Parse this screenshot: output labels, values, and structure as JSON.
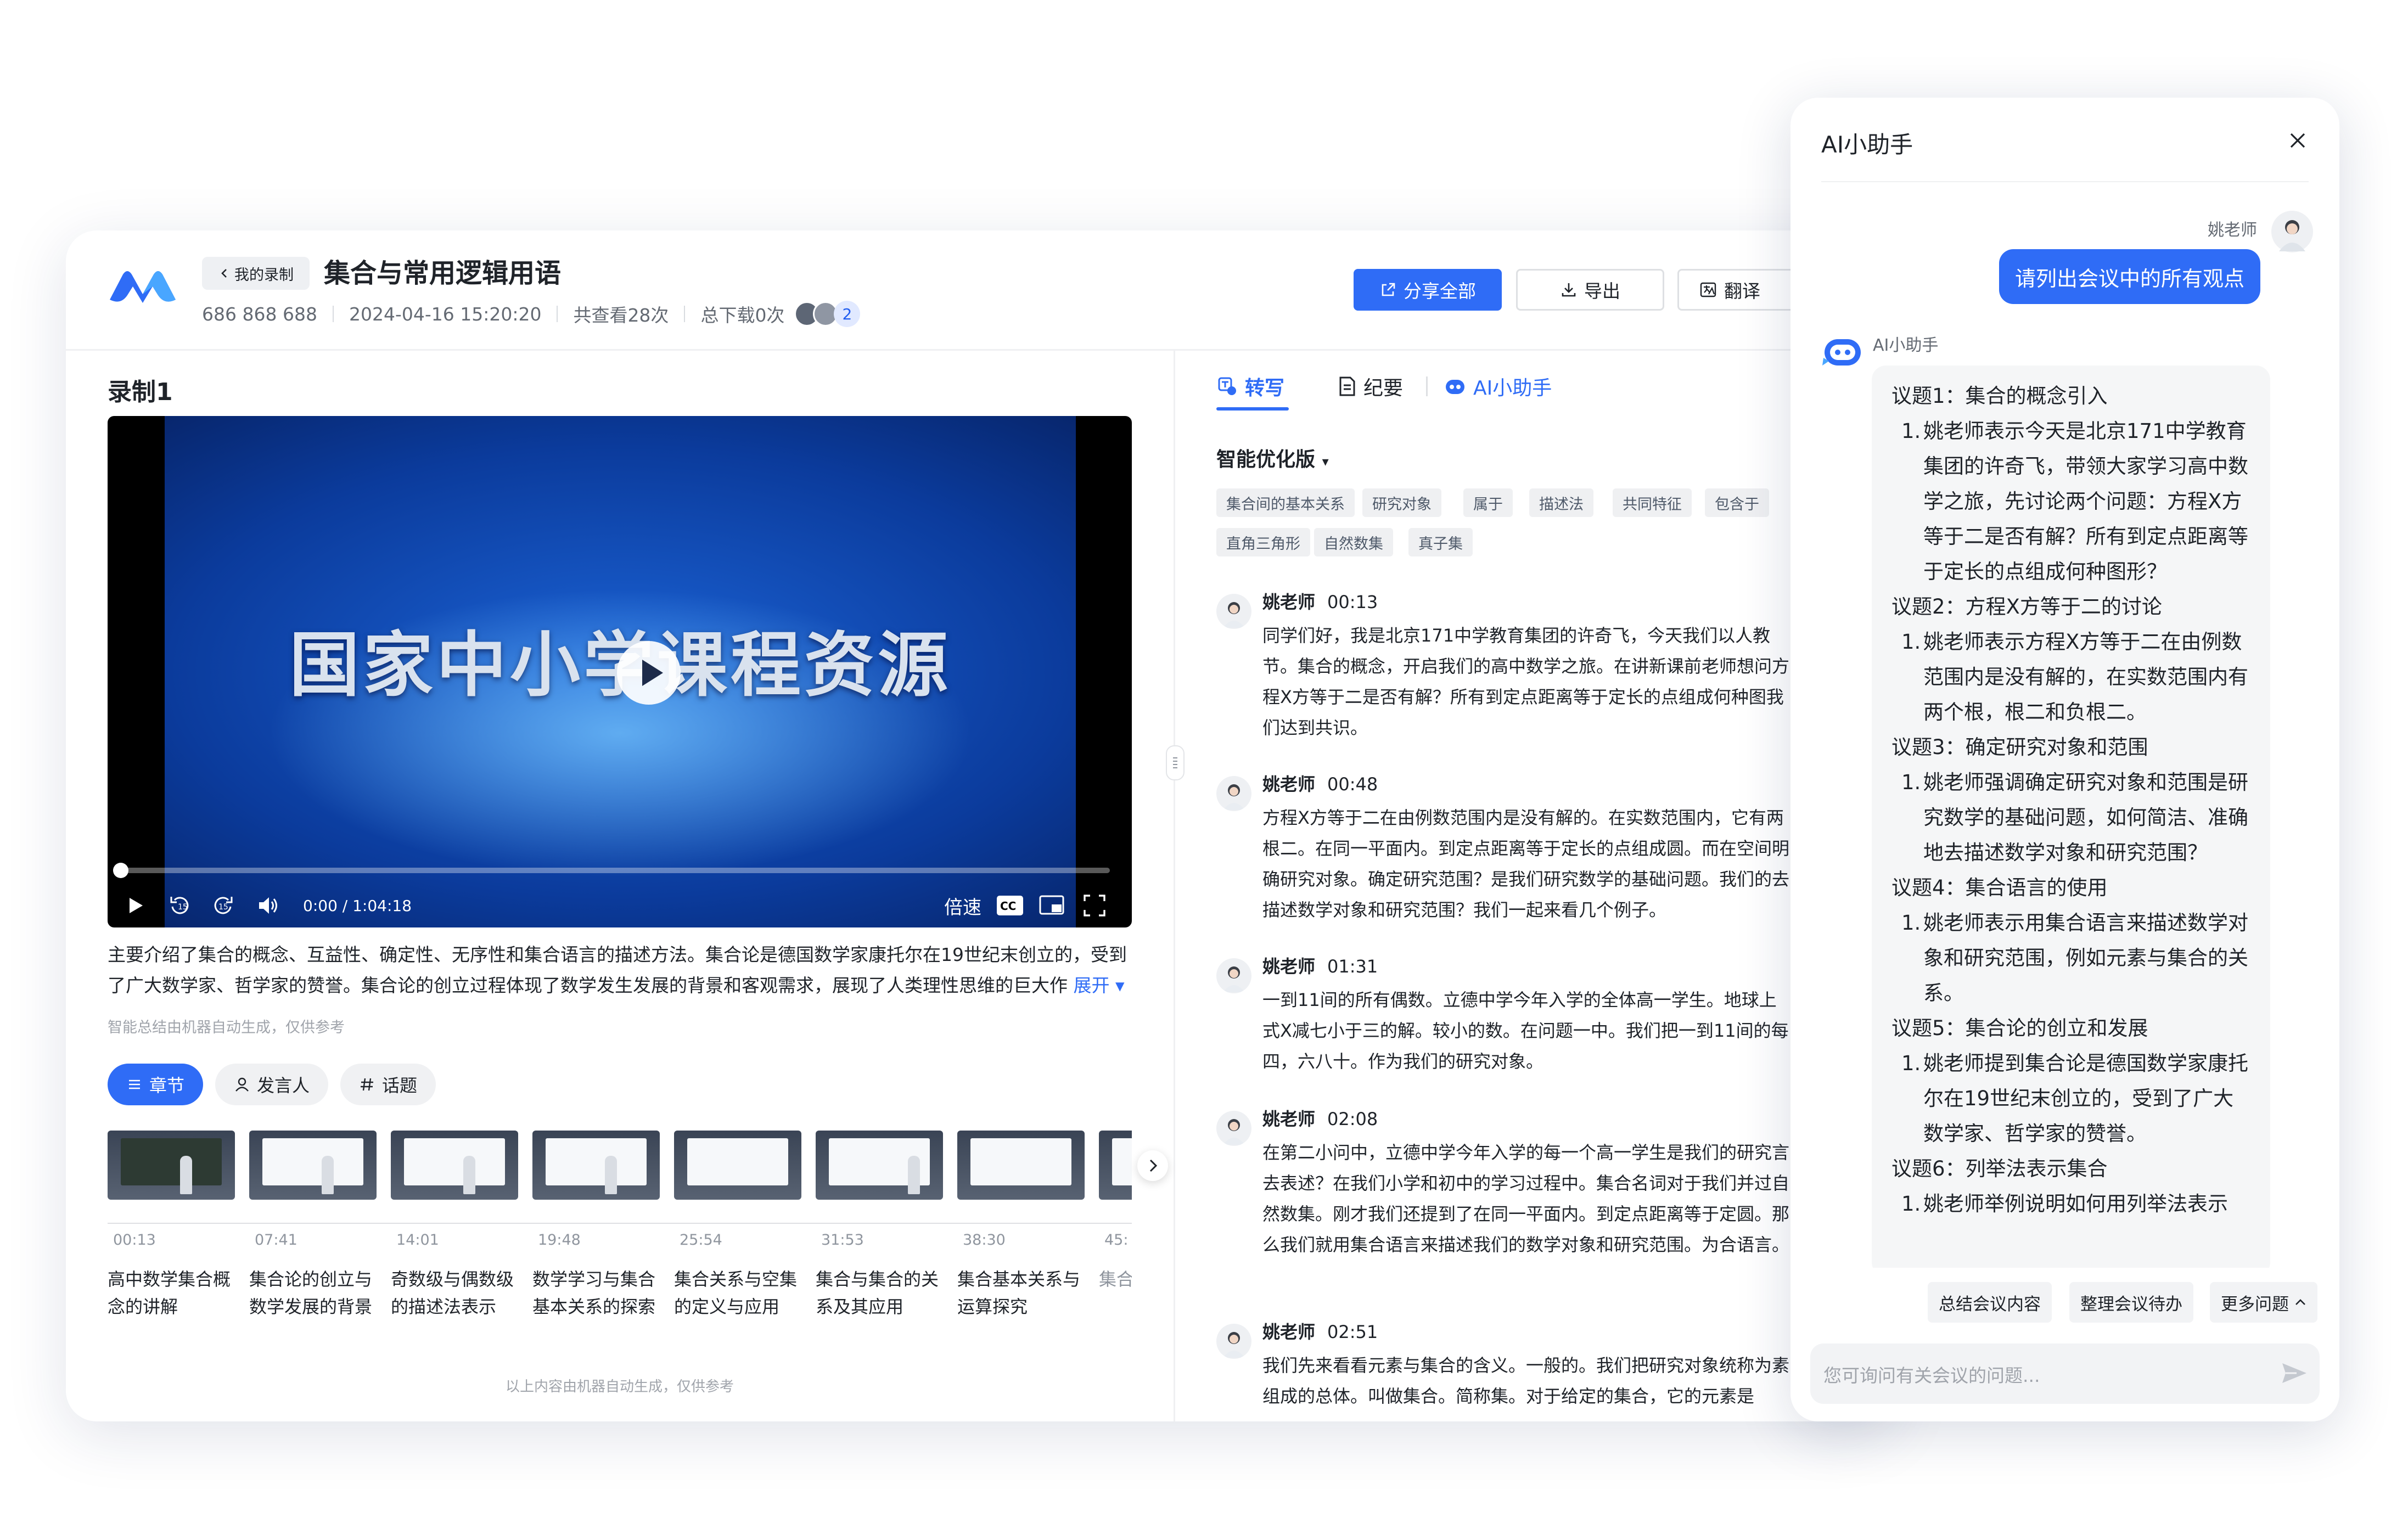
{
  "header": {
    "back_label": "我的录制",
    "title": "集合与常用逻辑用语",
    "meeting_id": "686 868 688",
    "datetime": "2024-04-16 15:20:20",
    "views": "共查看28次",
    "downloads": "总下载0次",
    "participants_count": "2",
    "share_label": "分享全部",
    "export_label": "导出",
    "translate_label": "翻译"
  },
  "recording": {
    "title": "录制1",
    "video_overlay_text": "国家中小学课程资源",
    "time": "0:00 / 1:04:18",
    "speed_label": "倍速",
    "summary": "主要介绍了集合的概念、互益性、确定性、无序性和集合语言的描述方法。集合论是德国数学家康托尔在19世纪末创立的，受到了广大数学家、哲学家的赞誉。集合论的创立过程体现了数学发生发展的背景和客观需求，展现了人类理性思维的巨大作",
    "expand_label": "展开",
    "auto_note": "智能总结由机器自动生成，仅供参考",
    "bottom_note": "以上内容由机器自动生成，仅供参考"
  },
  "left_tabs": [
    {
      "label": "章节"
    },
    {
      "label": "发言人"
    },
    {
      "label": "话题"
    }
  ],
  "chapters": [
    {
      "time": "00:13",
      "title": "高中数学集合概念的讲解"
    },
    {
      "time": "07:41",
      "title": "集合论的创立与数学发展的背景"
    },
    {
      "time": "14:01",
      "title": "奇数级与偶数级的描述法表示"
    },
    {
      "time": "19:48",
      "title": "数学学习与集合基本关系的探索"
    },
    {
      "time": "25:54",
      "title": "集合关系与空集的定义与应用"
    },
    {
      "time": "31:53",
      "title": "集合与集合的关系及其应用"
    },
    {
      "time": "38:30",
      "title": "集合基本关系与运算探究"
    },
    {
      "time": "45:",
      "title": "集合算理"
    }
  ],
  "right_tabs": [
    {
      "label": "转写"
    },
    {
      "label": "纪要"
    },
    {
      "label": "AI小助手"
    }
  ],
  "transcript": {
    "version_label": "智能优化版",
    "tags_row1": [
      "集合间的基本关系",
      "研究对象",
      "属于",
      "描述法",
      "共同特征",
      "包含于"
    ],
    "tags_row2": [
      "直角三角形",
      "自然数集",
      "真子集"
    ],
    "segments": [
      {
        "speaker": "姚老师",
        "time": "00:13",
        "text": "同学们好，我是北京171中学教育集团的许奇飞，今天我们以人教节。集合的概念，开启我们的高中数学之旅。在讲新课前老师想问方程X方等于二是否有解？所有到定点距离等于定长的点组成何种图我们达到共识。"
      },
      {
        "speaker": "姚老师",
        "time": "00:48",
        "text": "方程X方等于二在由例数范围内是没有解的。在实数范围内，它有两根二。在同一平面内。到定点距离等于定长的点组成圆。而在空间明确研究对象。确定研究范围？是我们研究数学的基础问题。我们的去描述数学对象和研究范围？我们一起来看几个例子。"
      },
      {
        "speaker": "姚老师",
        "time": "01:31",
        "text": "一到11间的所有偶数。立德中学今年入学的全体高一学生。地球上式X减七小于三的解。较小的数。在问题一中。我们把一到11间的每四，六八十。作为我们的研究对象。"
      },
      {
        "speaker": "姚老师",
        "time": "02:08",
        "text": "在第二小问中，立德中学今年入学的每一个高一学生是我们的研究言去表述？在我们小学和初中的学习过程中。集合名词对于我们并过自然数集。刚才我们还提到了在同一平面内。到定点距离等于定圆。那么我们就用集合语言来描述我们的数学对象和研究范围。为合语言。"
      },
      {
        "speaker": "姚老师",
        "time": "02:51",
        "text": "我们先来看看元素与集合的含义。一般的。我们把研究对象统称为素组成的总体。叫做集合。简称集。对于给定的集合，它的元素是"
      }
    ]
  },
  "ai_panel": {
    "title": "AI小助手",
    "user_name": "姚老师",
    "user_message": "请列出会议中的所有观点",
    "bot_name": "AI小助手",
    "answer": [
      {
        "topic": "议题1：集合的概念引入",
        "items": [
          "姚老师表示今天是北京171中学教育集团的许奇飞，带领大家学习高中数学之旅，先讨论两个问题：方程X方等于二是否有解？所有到定点距离等于定长的点组成何种图形？"
        ]
      },
      {
        "topic": "议题2：方程X方等于二的讨论",
        "items": [
          "姚老师表示方程X方等于二在由例数范围内是没有解的，在实数范围内有两个根，根二和负根二。"
        ]
      },
      {
        "topic": "议题3：确定研究对象和范围",
        "items": [
          "姚老师强调确定研究对象和范围是研究数学的基础问题，如何简洁、准确地去描述数学对象和研究范围？"
        ]
      },
      {
        "topic": "议题4：集合语言的使用",
        "items": [
          "姚老师表示用集合语言来描述数学对象和研究范围，例如元素与集合的关系。"
        ]
      },
      {
        "topic": "议题5：集合论的创立和发展",
        "items": [
          "姚老师提到集合论是德国数学家康托尔在19世纪末创立的，受到了广大数学家、哲学家的赞誉。"
        ]
      },
      {
        "topic": "议题6：列举法表示集合",
        "items": [
          "姚老师举例说明如何用列举法表示"
        ]
      }
    ],
    "quick_actions": [
      "总结会议内容",
      "整理会议待办",
      "更多问题"
    ],
    "input_placeholder": "您可询问有关会议的问题..."
  },
  "colors": {
    "accent": "#2f6cf6",
    "text": "#1f2329",
    "muted": "#646a73"
  }
}
